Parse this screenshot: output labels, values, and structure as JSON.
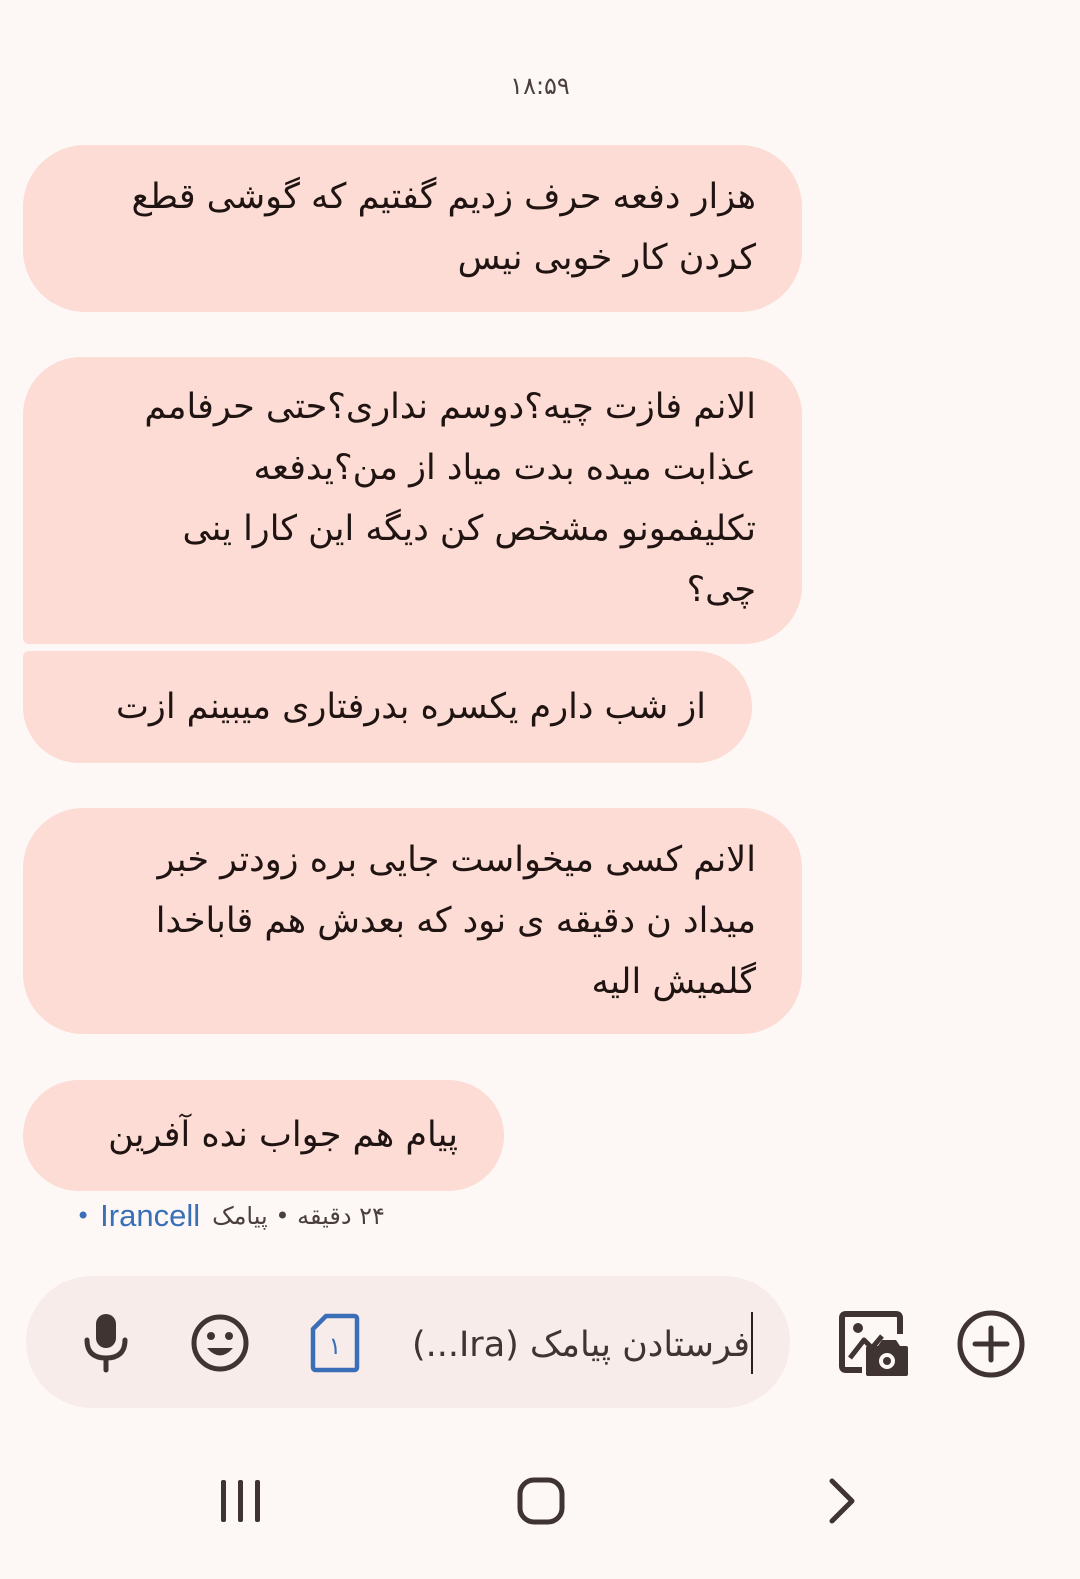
{
  "status": {
    "time": "۱۸:۵۹"
  },
  "messages": [
    {
      "lines": [
        "هزار دفعه حرف زدیم گفتیم که گوشی قطع",
        "کردن کار خوبی نیس"
      ]
    },
    {
      "lines": [
        "الانم فازت چیه؟دوسم نداری؟حتی حرفامم",
        "عذابت میده بدت میاد از من؟یدفعه",
        "تکلیفمونو مشخص کن دیگه این کارا ینی",
        "چی؟"
      ]
    },
    {
      "lines": [
        "از شب دارم یکسره بدرفتاری میبینم ازت"
      ]
    },
    {
      "lines": [
        "الانم کسی میخواست جایی بره زودتر خبر",
        "میداد ن دقیقه ی نود که بعدش هم قاباخدا",
        "گلمیش الیه"
      ]
    },
    {
      "lines": [
        "پیام هم جواب نده آفرین"
      ]
    }
  ],
  "meta": {
    "time_ago": "۲۴ دقیقه",
    "separator": "•",
    "type": "پیامک",
    "carrier": "Irancell"
  },
  "composer": {
    "placeholder": "فرستادن پیامک (Ira...)",
    "sim_label": "۱"
  },
  "icons": {
    "mic": "microphone-icon",
    "emoji": "emoji-icon",
    "sim": "sim-card-icon",
    "gallery": "gallery-camera-icon",
    "add": "add-circle-icon",
    "recent": "recent-apps-icon",
    "home": "home-icon",
    "back": "back-icon"
  },
  "colors": {
    "background": "#fdf8f6",
    "bubble": "#fcdcd4",
    "composer": "#f7ece9",
    "accent": "#3a6fb8"
  }
}
